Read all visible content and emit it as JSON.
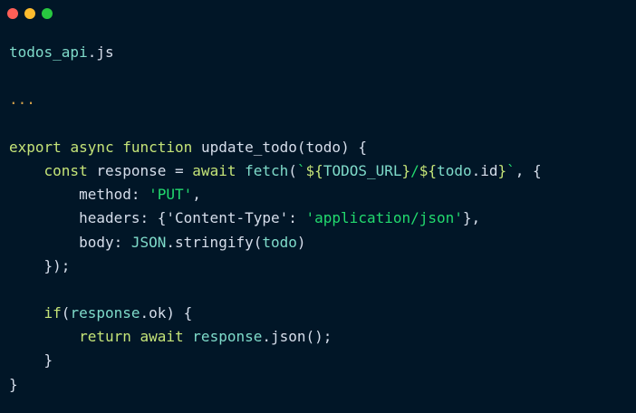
{
  "window": {
    "dots": [
      {
        "name": "close-dot",
        "color": "#ff5f57"
      },
      {
        "name": "minimize-dot",
        "color": "#febc2e"
      },
      {
        "name": "maximize-dot",
        "color": "#28c840"
      }
    ]
  },
  "colors": {
    "default": "#d6deeb",
    "keyword": "#c5e478",
    "identifier": "#7fdbca",
    "string": "#22da6e",
    "comment": "#d6a24a",
    "template": "#c3e88d"
  },
  "code": {
    "lines": [
      [
        {
          "t": "todos_api",
          "c": "identifier"
        },
        {
          "t": ".js",
          "c": "default"
        }
      ],
      [],
      [
        {
          "t": "...",
          "c": "comment"
        }
      ],
      [],
      [
        {
          "t": "export ",
          "c": "keyword"
        },
        {
          "t": "async ",
          "c": "keyword"
        },
        {
          "t": "function ",
          "c": "keyword"
        },
        {
          "t": "update_todo(todo) {",
          "c": "default"
        }
      ],
      [
        {
          "t": "    ",
          "c": "default"
        },
        {
          "t": "const ",
          "c": "keyword"
        },
        {
          "t": "response = ",
          "c": "default"
        },
        {
          "t": "await ",
          "c": "keyword"
        },
        {
          "t": "fetch",
          "c": "identifier"
        },
        {
          "t": "(",
          "c": "default"
        },
        {
          "t": "`",
          "c": "string"
        },
        {
          "t": "${",
          "c": "keyword"
        },
        {
          "t": "TODOS_URL",
          "c": "identifier"
        },
        {
          "t": "}",
          "c": "keyword"
        },
        {
          "t": "/",
          "c": "string"
        },
        {
          "t": "${",
          "c": "keyword"
        },
        {
          "t": "todo",
          "c": "identifier"
        },
        {
          "t": ".id",
          "c": "default"
        },
        {
          "t": "}",
          "c": "keyword"
        },
        {
          "t": "`",
          "c": "string"
        },
        {
          "t": ", {",
          "c": "default"
        }
      ],
      [
        {
          "t": "        method: ",
          "c": "default"
        },
        {
          "t": "'PUT'",
          "c": "string"
        },
        {
          "t": ",",
          "c": "default"
        }
      ],
      [
        {
          "t": "        headers: {'Content-Type': ",
          "c": "default"
        },
        {
          "t": "'application/json'",
          "c": "string"
        },
        {
          "t": "},",
          "c": "default"
        }
      ],
      [
        {
          "t": "        body: ",
          "c": "default"
        },
        {
          "t": "JSON",
          "c": "identifier"
        },
        {
          "t": ".stringify(",
          "c": "default"
        },
        {
          "t": "todo",
          "c": "identifier"
        },
        {
          "t": ")",
          "c": "default"
        }
      ],
      [
        {
          "t": "    });",
          "c": "default"
        }
      ],
      [],
      [
        {
          "t": "    ",
          "c": "default"
        },
        {
          "t": "if",
          "c": "keyword"
        },
        {
          "t": "(",
          "c": "default"
        },
        {
          "t": "response",
          "c": "identifier"
        },
        {
          "t": ".ok) {",
          "c": "default"
        }
      ],
      [
        {
          "t": "        ",
          "c": "default"
        },
        {
          "t": "return ",
          "c": "keyword"
        },
        {
          "t": "await ",
          "c": "keyword"
        },
        {
          "t": "response",
          "c": "identifier"
        },
        {
          "t": ".json();",
          "c": "default"
        }
      ],
      [
        {
          "t": "    }",
          "c": "default"
        }
      ],
      [
        {
          "t": "}",
          "c": "default"
        }
      ]
    ]
  }
}
